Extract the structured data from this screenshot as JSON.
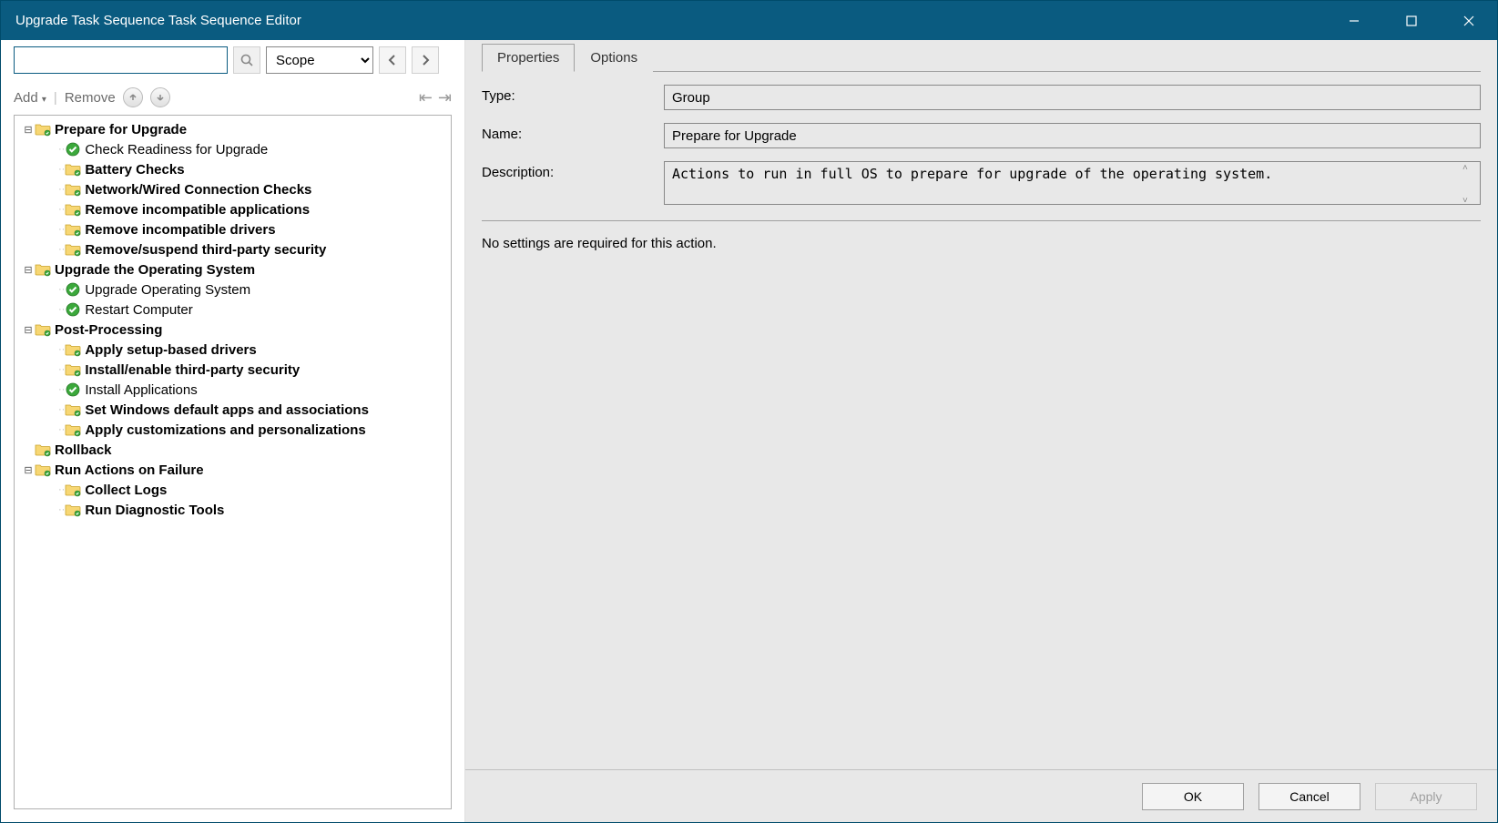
{
  "window": {
    "title": "Upgrade Task Sequence Task Sequence Editor"
  },
  "toolbar": {
    "search_value": "",
    "scope_label": "Scope",
    "add_label": "Add",
    "remove_label": "Remove"
  },
  "tree": [
    {
      "depth": 0,
      "exp": "-",
      "icon": "folder",
      "bold": true,
      "label": "Prepare for Upgrade"
    },
    {
      "depth": 1,
      "exp": "",
      "icon": "check",
      "bold": false,
      "label": "Check Readiness for Upgrade"
    },
    {
      "depth": 1,
      "exp": "",
      "icon": "folder",
      "bold": true,
      "label": "Battery Checks"
    },
    {
      "depth": 1,
      "exp": "",
      "icon": "folder",
      "bold": true,
      "label": "Network/Wired Connection Checks"
    },
    {
      "depth": 1,
      "exp": "",
      "icon": "folder",
      "bold": true,
      "label": "Remove incompatible applications"
    },
    {
      "depth": 1,
      "exp": "",
      "icon": "folder",
      "bold": true,
      "label": "Remove incompatible drivers"
    },
    {
      "depth": 1,
      "exp": "",
      "icon": "folder",
      "bold": true,
      "label": "Remove/suspend third-party security"
    },
    {
      "depth": 0,
      "exp": "-",
      "icon": "folder",
      "bold": true,
      "label": "Upgrade the Operating System"
    },
    {
      "depth": 1,
      "exp": "",
      "icon": "check",
      "bold": false,
      "label": "Upgrade Operating System"
    },
    {
      "depth": 1,
      "exp": "",
      "icon": "check",
      "bold": false,
      "label": "Restart Computer"
    },
    {
      "depth": 0,
      "exp": "-",
      "icon": "folder",
      "bold": true,
      "label": "Post-Processing"
    },
    {
      "depth": 1,
      "exp": "",
      "icon": "folder",
      "bold": true,
      "label": "Apply setup-based drivers"
    },
    {
      "depth": 1,
      "exp": "",
      "icon": "folder",
      "bold": true,
      "label": "Install/enable third-party security"
    },
    {
      "depth": 1,
      "exp": "",
      "icon": "check",
      "bold": false,
      "label": "Install Applications"
    },
    {
      "depth": 1,
      "exp": "",
      "icon": "folder",
      "bold": true,
      "label": "Set Windows default apps and associations"
    },
    {
      "depth": 1,
      "exp": "",
      "icon": "folder",
      "bold": true,
      "label": "Apply customizations and personalizations"
    },
    {
      "depth": 0,
      "exp": "",
      "icon": "folder",
      "bold": true,
      "label": "Rollback"
    },
    {
      "depth": 0,
      "exp": "-",
      "icon": "folder",
      "bold": true,
      "label": "Run Actions on Failure"
    },
    {
      "depth": 1,
      "exp": "",
      "icon": "folder",
      "bold": true,
      "label": "Collect Logs"
    },
    {
      "depth": 1,
      "exp": "",
      "icon": "folder",
      "bold": true,
      "label": "Run Diagnostic Tools"
    }
  ],
  "tabs": {
    "properties": "Properties",
    "options": "Options"
  },
  "properties": {
    "type_label": "Type:",
    "type_value": "Group",
    "name_label": "Name:",
    "name_value": "Prepare for Upgrade",
    "desc_label": "Description:",
    "desc_value": "Actions to run in full OS to prepare for upgrade of the operating system.",
    "settings_msg": "No settings are required for this action."
  },
  "buttons": {
    "ok": "OK",
    "cancel": "Cancel",
    "apply": "Apply"
  }
}
